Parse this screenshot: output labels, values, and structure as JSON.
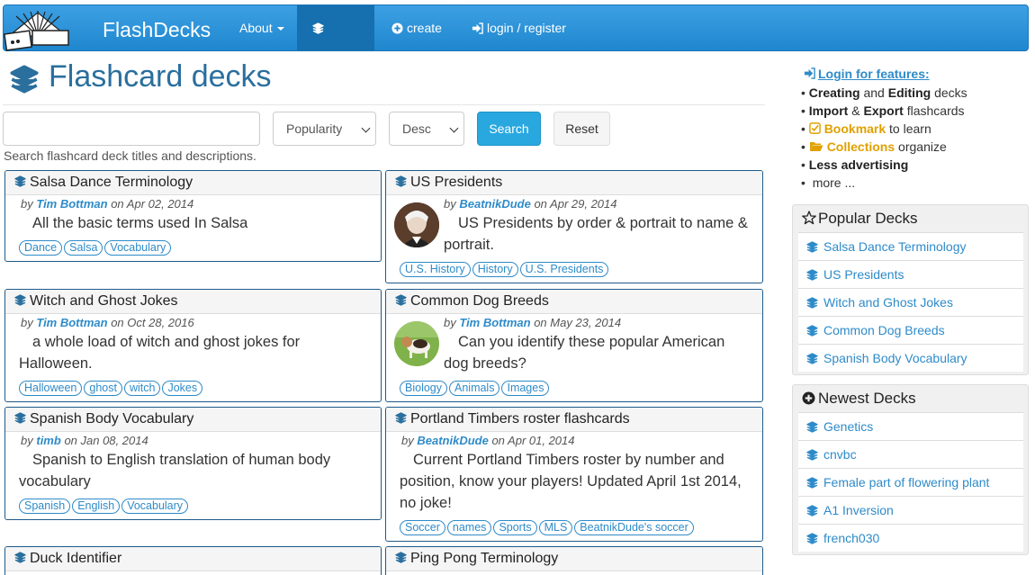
{
  "nav": {
    "brand": "FlashDecks",
    "about": "About",
    "decks": "decks",
    "create": "create",
    "login": "login / register"
  },
  "page": {
    "title": "Flashcard decks"
  },
  "search": {
    "input_value": "",
    "sort": "Popularity",
    "order": "Desc",
    "search_label": "Search",
    "reset_label": "Reset",
    "help": "Search flashcard deck titles and descriptions."
  },
  "decks": [
    {
      "title": "Salsa Dance Terminology",
      "by": "by",
      "author": "Tim Bottman",
      "on": "on Apr 02, 2014",
      "desc": "All the basic terms used In Salsa",
      "tags": [
        "Dance",
        "Salsa",
        "Vocabulary"
      ]
    },
    {
      "title": "US Presidents",
      "by": "by",
      "author": "BeatnikDude",
      "on": "on Apr 29, 2014",
      "desc": "US Presidents by order & portrait to name & portrait.",
      "tags": [
        "U.S. History",
        "History",
        "U.S. Presidents"
      ]
    },
    {
      "title": "Witch and Ghost Jokes",
      "by": "by",
      "author": "Tim Bottman",
      "on": "on Oct 28, 2016",
      "desc": "a whole load of witch and ghost jokes for Halloween.",
      "tags": [
        "Halloween",
        "ghost",
        "witch",
        "Jokes"
      ]
    },
    {
      "title": "Common Dog Breeds",
      "by": "by",
      "author": "Tim Bottman",
      "on": "on May 23, 2014",
      "desc": "Can you identify these popular American dog breeds?",
      "tags": [
        "Biology",
        "Animals",
        "Images"
      ]
    },
    {
      "title": "Spanish Body Vocabulary",
      "by": "by",
      "author": "timb",
      "on": "on Jan 08, 2014",
      "desc": "Spanish to English translation of human body vocabulary",
      "tags": [
        "Spanish",
        "English",
        "Vocabulary"
      ]
    },
    {
      "title": "Portland Timbers roster flashcards",
      "by": "by",
      "author": "BeatnikDude",
      "on": "on Apr 01, 2014",
      "desc": "Current Portland Timbers roster by number and position, know your players! Updated April 1st 2014, no joke!",
      "tags": [
        "Soccer",
        "names",
        "Sports",
        "MLS",
        "BeatnikDude's soccer"
      ]
    },
    {
      "title": "Duck Identifier"
    },
    {
      "title": "Ping Pong Terminology"
    }
  ],
  "sidebar": {
    "login_link": "Login for features:",
    "features": {
      "f1a": "Creating",
      "f1b": "and",
      "f1c": "Editing",
      "f1d": "decks",
      "f2a": "Import",
      "f2b": "&",
      "f2c": "Export",
      "f2d": "flashcards",
      "f3a": "Bookmark",
      "f3b": "to learn",
      "f4a": "Collections",
      "f4b": "organize",
      "f5": "Less advertising",
      "f6": "more ..."
    },
    "popular": {
      "title": "Popular Decks",
      "items": [
        "Salsa Dance Terminology",
        "US Presidents",
        "Witch and Ghost Jokes",
        "Common Dog Breeds",
        "Spanish Body Vocabulary"
      ]
    },
    "newest": {
      "title": "Newest Decks",
      "items": [
        "Genetics",
        "cnvbc",
        "Female part of flowering plant",
        "A1 Inversion",
        "french030"
      ]
    }
  },
  "colors": {
    "brand_blue": "#1f87cf",
    "link": "#2e8bc9",
    "gold": "#e0a100"
  }
}
